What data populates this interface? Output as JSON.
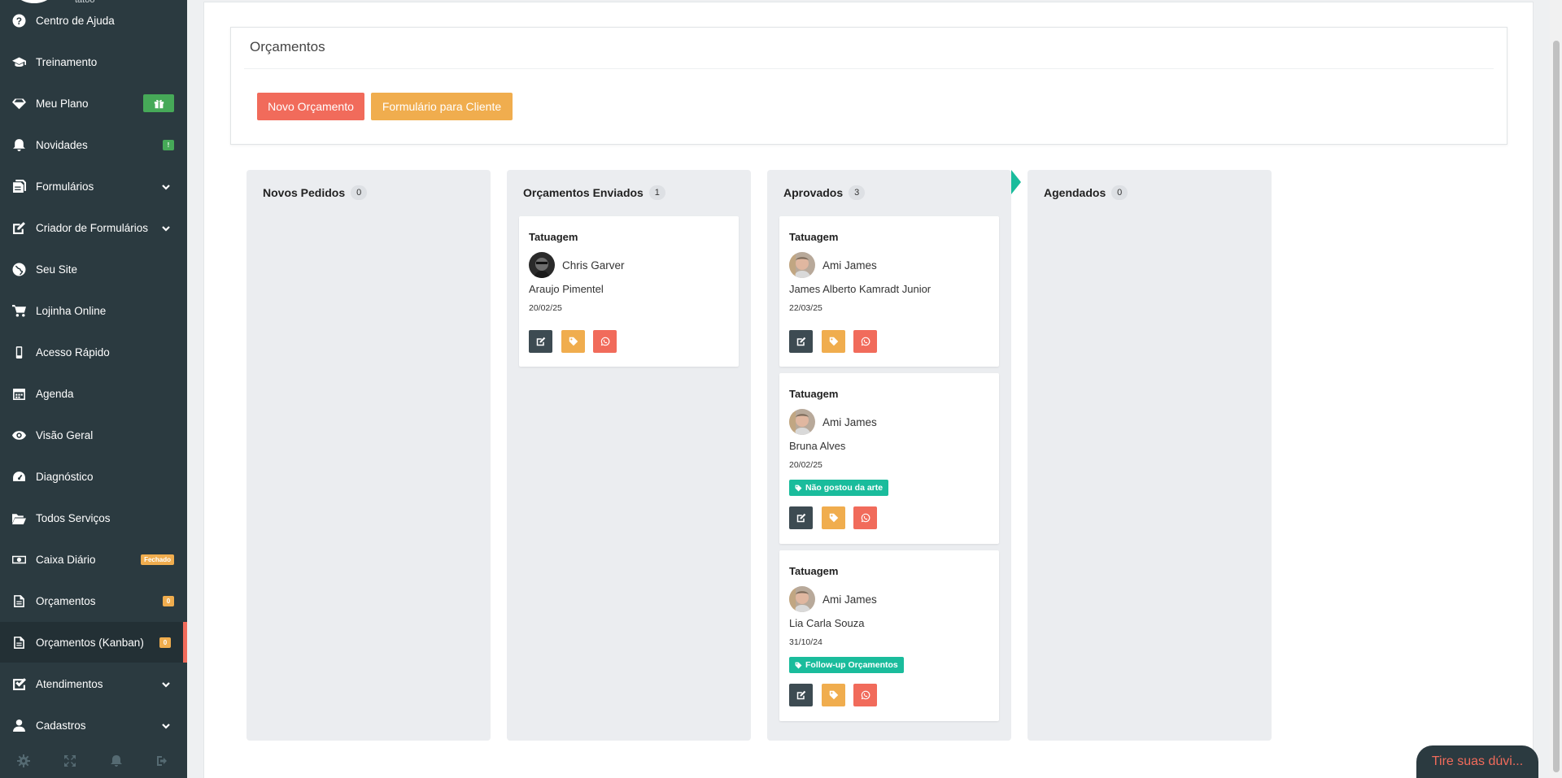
{
  "sidebar": {
    "top_cut_text": "tatoo",
    "items": [
      {
        "label": "Centro de Ajuda",
        "icon": "question-circle-icon"
      },
      {
        "label": "Treinamento",
        "icon": "graduation-cap-icon"
      },
      {
        "label": "Meu Plano",
        "icon": "diamond-icon",
        "badge_icon": "gift-icon"
      },
      {
        "label": "Novidades",
        "icon": "bell-icon",
        "badge": "!"
      },
      {
        "label": "Formulários",
        "icon": "file-text-icon"
      },
      {
        "label": "Criador de Formulários",
        "icon": "edit-icon"
      },
      {
        "label": "Seu Site",
        "icon": "globe-icon"
      },
      {
        "label": "Lojinha Online",
        "icon": "shopping-cart-icon"
      },
      {
        "label": "Acesso Rápido",
        "icon": "mobile-icon"
      },
      {
        "label": "Agenda",
        "icon": "calendar-icon"
      },
      {
        "label": "Visão Geral",
        "icon": "eye-icon"
      },
      {
        "label": "Diagnóstico",
        "icon": "dashboard-icon"
      },
      {
        "label": "Todos Serviços",
        "icon": "folder-open-icon"
      },
      {
        "label": "Caixa Diário",
        "icon": "money-icon",
        "badge": "Fechado"
      },
      {
        "label": "Orçamentos",
        "icon": "document-icon",
        "badge": "0"
      },
      {
        "label": "Orçamentos (Kanban)",
        "icon": "document-icon",
        "badge": "0"
      },
      {
        "label": "Atendimentos",
        "icon": "check-square-icon"
      },
      {
        "label": "Cadastros",
        "icon": "user-icon"
      }
    ],
    "footer_icons": [
      "gear-icon",
      "fullscreen-icon",
      "bell-icon",
      "logout-icon"
    ]
  },
  "panel": {
    "title": "Orçamentos",
    "new_button": "Novo Orçamento",
    "form_button": "Formulário para Cliente"
  },
  "columns": [
    {
      "title": "Novos Pedidos",
      "count": "0",
      "cards": []
    },
    {
      "title": "Orçamentos Enviados",
      "count": "1",
      "cards": [
        {
          "service": "Tatuagem",
          "artist": "Chris Garver",
          "client": "Araujo Pimentel",
          "date": "20/02/25",
          "tag": ""
        }
      ]
    },
    {
      "title": "Aprovados",
      "count": "3",
      "cards": [
        {
          "service": "Tatuagem",
          "artist": "Ami James",
          "client": "James Alberto Kamradt Junior",
          "date": "22/03/25",
          "tag": ""
        },
        {
          "service": "Tatuagem",
          "artist": "Ami James",
          "client": "Bruna Alves",
          "date": "20/02/25",
          "tag": "Não gostou da arte"
        },
        {
          "service": "Tatuagem",
          "artist": "Ami James",
          "client": "Lia Carla Souza",
          "date": "31/10/24",
          "tag": "Follow-up Orçamentos"
        }
      ]
    },
    {
      "title": "Agendados",
      "count": "0",
      "cards": []
    }
  ],
  "chat_widget": {
    "label": "Tire suas dúvi..."
  },
  "colors": {
    "sidebar_bg": "#2b3a40",
    "accent_red": "#f16b5b",
    "accent_orange": "#f0ad4e",
    "tag_teal": "#1abc9c",
    "badge_green": "#46a958"
  }
}
